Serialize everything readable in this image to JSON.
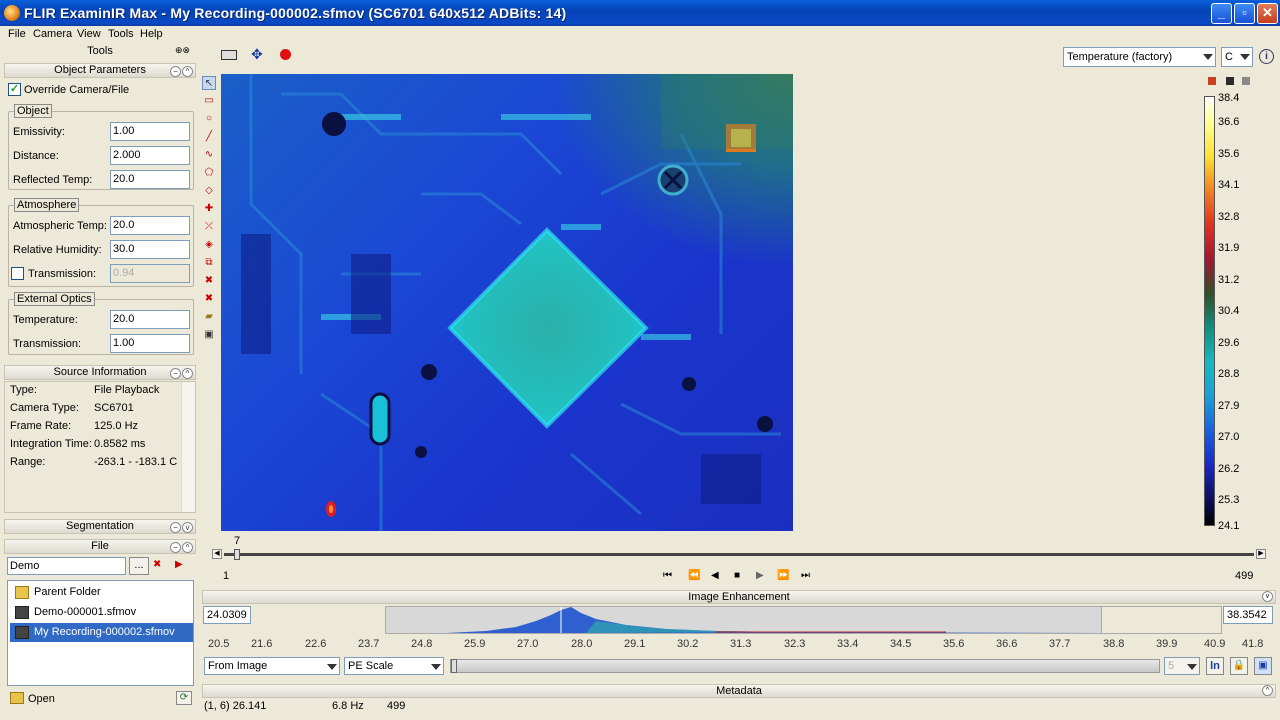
{
  "window": {
    "title": "FLIR ExaminIR Max - My Recording-000002.sfmov (SC6701 640x512 ADBits: 14)"
  },
  "menu": [
    "File",
    "Camera",
    "View",
    "Tools",
    "Help"
  ],
  "left": {
    "tools_title": "Tools",
    "object_params_title": "Object Parameters",
    "override_label": "Override Camera/File",
    "object_group": "Object",
    "emissivity_label": "Emissivity:",
    "emissivity": "1.00",
    "distance_label": "Distance:",
    "distance": "2.000",
    "reflected_label": "Reflected Temp:",
    "reflected": "20.0",
    "atmosphere_group": "Atmosphere",
    "atm_temp_label": "Atmospheric Temp:",
    "atm_temp": "20.0",
    "humidity_label": "Relative Humidity:",
    "humidity": "30.0",
    "transmission_label": "Transmission:",
    "transmission": "0.94",
    "ext_optics_group": "External Optics",
    "ext_temp_label": "Temperature:",
    "ext_temp": "20.0",
    "ext_trans_label": "Transmission:",
    "ext_trans": "1.00",
    "source_title": "Source Information",
    "source": [
      {
        "k": "Type:",
        "v": "File Playback"
      },
      {
        "k": "Camera Type:",
        "v": "SC6701"
      },
      {
        "k": "Frame Rate:",
        "v": "125.0 Hz"
      },
      {
        "k": "Integration Time:",
        "v": "0.8582 ms"
      },
      {
        "k": "Range:",
        "v": "-263.1 - -183.1 C"
      }
    ],
    "segmentation_title": "Segmentation",
    "file_title": "File",
    "folder": "Demo",
    "browse": "...",
    "files": [
      "Parent Folder",
      "Demo-000001.sfmov",
      "My Recording-000002.sfmov"
    ],
    "open_label": "Open"
  },
  "view": {
    "measure_select": "Temperature (factory)",
    "unit_select": "C",
    "colorbar_labels": [
      "38.4",
      "36.6",
      "35.6",
      "34.1",
      "32.8",
      "31.9",
      "31.2",
      "30.4",
      "29.6",
      "28.8",
      "27.9",
      "27.0",
      "26.2",
      "25.3",
      "24.1"
    ]
  },
  "timeline": {
    "current": "7",
    "start": "1",
    "end": "499"
  },
  "enhancement": {
    "title": "Image Enhancement",
    "min": "24.0309",
    "max": "38.3542",
    "scale": [
      "20.5",
      "21.6",
      "22.6",
      "23.7",
      "24.8",
      "25.9",
      "27.0",
      "28.0",
      "29.1",
      "30.2",
      "31.3",
      "32.3",
      "33.4",
      "34.5",
      "35.6",
      "36.6",
      "37.7",
      "38.8",
      "39.9",
      "40.9",
      "41.8"
    ],
    "source_select": "From Image",
    "scale_select": "PE Scale",
    "level": "5",
    "ln_label": "ln"
  },
  "metadata": {
    "title": "Metadata"
  },
  "status": {
    "pixel": "(1, 6) 26.141",
    "rate": "6.8 Hz",
    "frames": "499"
  }
}
